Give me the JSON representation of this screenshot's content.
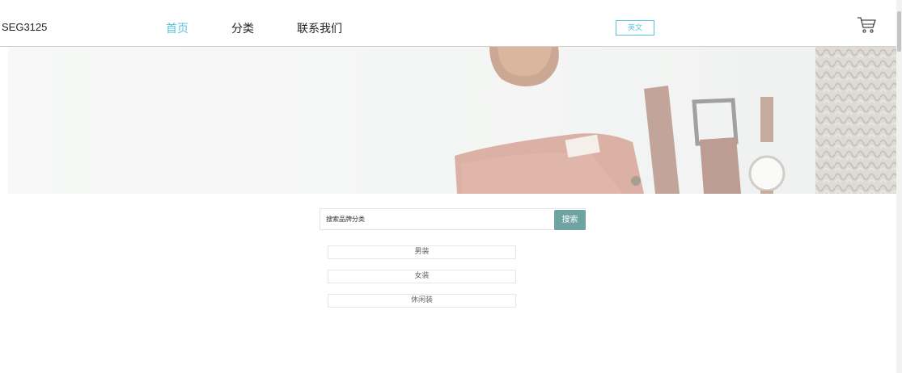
{
  "header": {
    "brand": "SEG3125",
    "nav": [
      {
        "label": "首页",
        "active": true
      },
      {
        "label": "分类",
        "active": false
      },
      {
        "label": "联系我们",
        "active": false
      }
    ],
    "language_button": "英文",
    "cart_icon": "shopping-cart-icon"
  },
  "hero": {
    "image": "fashion-accessories-banner"
  },
  "search": {
    "placeholder": "搜索品牌分类",
    "button_label": "搜索"
  },
  "categories": [
    "男装",
    "女装",
    "休闲装"
  ],
  "colors": {
    "accent": "#5bc0de",
    "search_button": "#6ea3a1",
    "border": "#e6e6e6"
  }
}
